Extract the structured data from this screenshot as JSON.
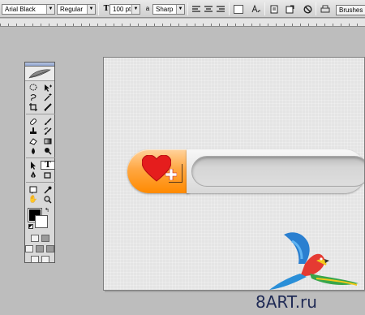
{
  "options_bar": {
    "font_family": "Arial Black",
    "font_style": "Regular",
    "font_size": "100 pt",
    "antialias": "Sharp",
    "brushes_tab": "Brushes"
  },
  "toolbox": {
    "tools": [
      "marquee",
      "move",
      "lasso",
      "magic-wand",
      "crop",
      "slice",
      "healing",
      "brush",
      "stamp",
      "history-brush",
      "eraser",
      "gradient",
      "blur",
      "dodge",
      "path-select",
      "type",
      "pen",
      "shape",
      "notes",
      "eyedropper",
      "hand",
      "zoom"
    ],
    "foreground_color": "#000000",
    "background_color": "#ffffff"
  },
  "document": {
    "pill_color": "#ff9a1e",
    "heart_color": "#e51d1d"
  },
  "watermark": "8ART.ru"
}
